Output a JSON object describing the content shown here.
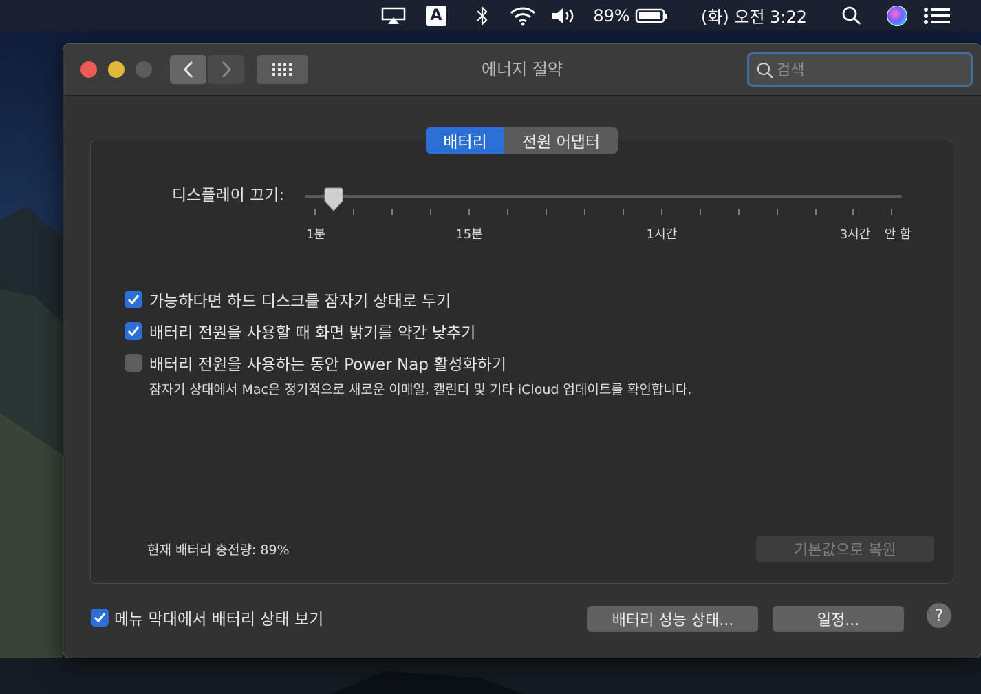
{
  "menubar": {
    "input_source": "A",
    "battery_percent": "89%",
    "datetime": "(화) 오전 3:22",
    "icons": [
      "airplay-icon",
      "input-source-icon",
      "bluetooth-icon",
      "wifi-icon",
      "volume-icon",
      "battery-icon",
      "spotlight-icon",
      "siri-icon",
      "notification-center-icon"
    ]
  },
  "window": {
    "title": "에너지 절약",
    "search": {
      "placeholder": "검색",
      "value": ""
    }
  },
  "tabs": [
    {
      "label": "배터리",
      "active": true
    },
    {
      "label": "전원 어댑터",
      "active": false
    }
  ],
  "display_off": {
    "label": "디스플레이 끄기:",
    "tick_labels": [
      "1분",
      "15분",
      "1시간",
      "3시간",
      "안 함"
    ],
    "selected": "1분"
  },
  "options": [
    {
      "label": "가능하다면 하드 디스크를 잠자기 상태로 두기",
      "checked": true
    },
    {
      "label": "배터리 전원을 사용할 때 화면 밝기를 약간 낮추기",
      "checked": true
    },
    {
      "label": "배터리 전원을 사용하는 동안 Power Nap 활성화하기",
      "checked": false,
      "description": "잠자기 상태에서 Mac은 정기적으로 새로운 이메일, 캘린더 및 기타 iCloud 업데이트를 확인합니다."
    }
  ],
  "battery_charge": "현재 배터리 충전량: 89%",
  "restore_defaults": "기본값으로 복원",
  "show_in_menubar": {
    "label": "메뉴 막대에서 배터리 상태 보기",
    "checked": true
  },
  "battery_health_button": "배터리 성능 상태...",
  "schedule_button": "일정...",
  "help_button": "?",
  "colors": {
    "accent": "#2c6fd6",
    "close": "#ee5b55",
    "minimize": "#e1b93a",
    "zoom": "#5c5c5c"
  }
}
